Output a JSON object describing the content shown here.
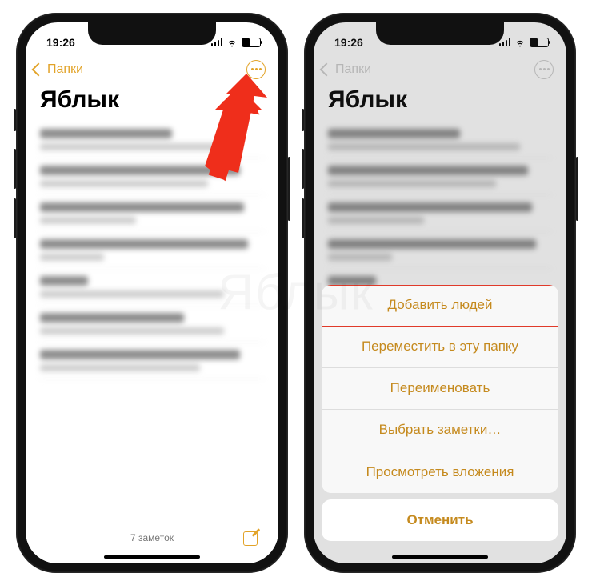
{
  "status": {
    "time": "19:26"
  },
  "nav": {
    "back_label": "Папки"
  },
  "page": {
    "title": "Яблык"
  },
  "footer": {
    "count": "7 заметок"
  },
  "sheet": {
    "items": [
      "Добавить людей",
      "Переместить в эту папку",
      "Переименовать",
      "Выбрать заметки…",
      "Просмотреть вложения"
    ],
    "cancel": "Отменить"
  },
  "watermark": "Яблык",
  "notes_blurred": [
    {
      "w1": 165,
      "w2": 240
    },
    {
      "w1": 250,
      "w2": 210
    },
    {
      "w1": 255,
      "w2": 120
    },
    {
      "w1": 260,
      "w2": 80
    },
    {
      "w1": 60,
      "w2": 230
    },
    {
      "w1": 180,
      "w2": 230
    },
    {
      "w1": 250,
      "w2": 200
    }
  ]
}
